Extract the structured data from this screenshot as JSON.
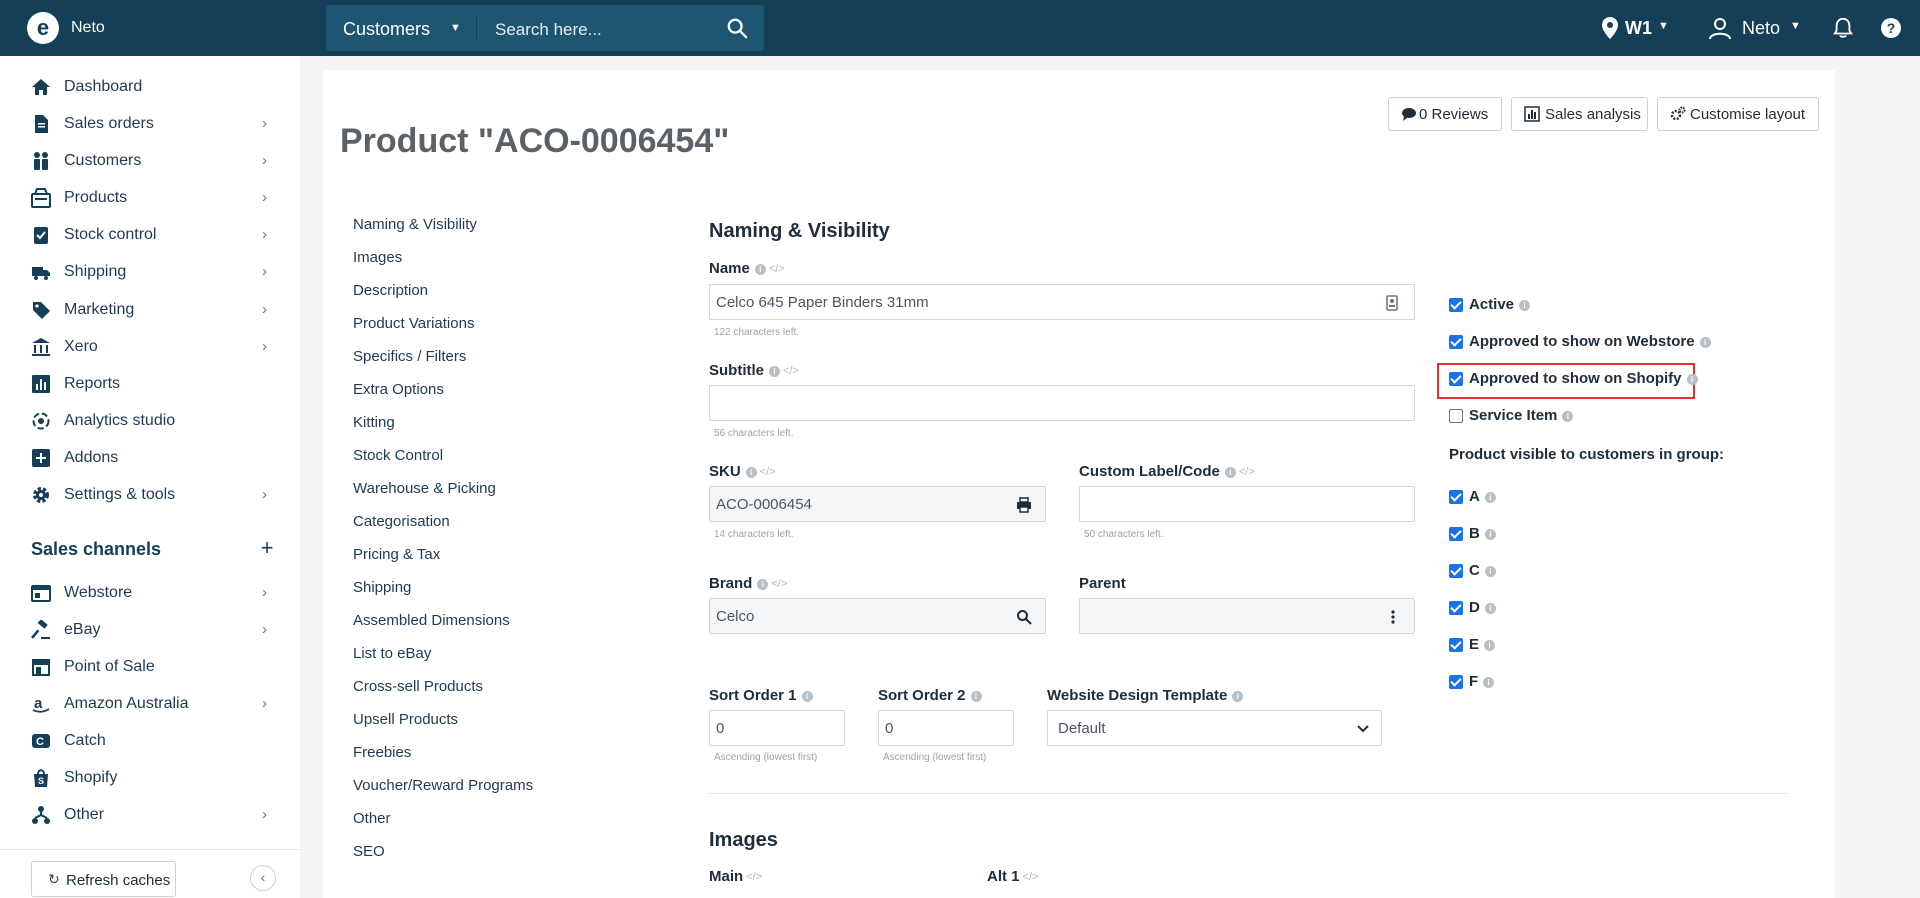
{
  "topbar": {
    "brand": "Neto",
    "search_type": "Customers",
    "search_placeholder": "Search here...",
    "location": "W1",
    "user": "Neto",
    "help": "?"
  },
  "sidebar": {
    "items": [
      {
        "label": "Dashboard",
        "icon": "home-icon"
      },
      {
        "label": "Sales orders",
        "icon": "document-icon"
      },
      {
        "label": "Customers",
        "icon": "people-icon"
      },
      {
        "label": "Products",
        "icon": "products-icon"
      },
      {
        "label": "Stock control",
        "icon": "clipboard-check-icon"
      },
      {
        "label": "Shipping",
        "icon": "truck-icon"
      },
      {
        "label": "Marketing",
        "icon": "tag-icon"
      },
      {
        "label": "Xero",
        "icon": "bank-icon"
      },
      {
        "label": "Reports",
        "icon": "bar-chart-icon"
      },
      {
        "label": "Analytics studio",
        "icon": "analytics-icon"
      },
      {
        "label": "Addons",
        "icon": "plus-square-icon"
      },
      {
        "label": "Settings & tools",
        "icon": "gear-icon"
      }
    ],
    "sales_channels_heading": "Sales channels",
    "sales_channels_add": "+",
    "channels": [
      {
        "label": "Webstore",
        "icon": "webstore-icon"
      },
      {
        "label": "eBay",
        "icon": "gavel-icon"
      },
      {
        "label": "Point of Sale",
        "icon": "store-icon"
      },
      {
        "label": "Amazon Australia",
        "icon": "amazon-icon"
      },
      {
        "label": "Catch",
        "icon": "catch-icon"
      },
      {
        "label": "Shopify",
        "icon": "shopify-bag-icon"
      },
      {
        "label": "Other",
        "icon": "sitemap-icon"
      }
    ],
    "refresh_label": "Refresh caches",
    "collapse_label": "‹"
  },
  "page": {
    "title": "Product \"ACO-0006454\"",
    "buttons": {
      "reviews": "0 Reviews",
      "sales_analysis": "Sales analysis",
      "customise_layout": "Customise layout"
    }
  },
  "section_nav": [
    "Naming & Visibility",
    "Images",
    "Description",
    "Product Variations",
    "Specifics / Filters",
    "Extra Options",
    "Kitting",
    "Stock Control",
    "Warehouse & Picking",
    "Categorisation",
    "Pricing & Tax",
    "Shipping",
    "Assembled Dimensions",
    "List to eBay",
    "Cross-sell Products",
    "Upsell Products",
    "Freebies",
    "Voucher/Reward Programs",
    "Other",
    "SEO"
  ],
  "form": {
    "section_title": "Naming & Visibility",
    "name_label": "Name",
    "name_value": "Celco 645 Paper Binders 31mm",
    "name_helper": "122 characters left.",
    "subtitle_label": "Subtitle",
    "subtitle_value": "",
    "subtitle_helper": "56 characters left.",
    "sku_label": "SKU",
    "sku_value": "ACO-0006454",
    "sku_helper": "14 characters left.",
    "custom_label": "Custom Label/Code",
    "custom_value": "",
    "custom_helper": "50 characters left.",
    "brand_label": "Brand",
    "brand_value": "Celco",
    "parent_label": "Parent",
    "parent_value": "",
    "sort1_label": "Sort Order 1",
    "sort1_value": "0",
    "sort1_helper": "Ascending (lowest first)",
    "sort2_label": "Sort Order 2",
    "sort2_value": "0",
    "sort2_helper": "Ascending (lowest first)",
    "template_label": "Website Design Template",
    "template_value": "Default",
    "images_title": "Images",
    "main_label": "Main",
    "alt1_label": "Alt 1"
  },
  "visibility": {
    "options": [
      {
        "label": "Active",
        "checked": true
      },
      {
        "label": "Approved to show on Webstore",
        "checked": true
      },
      {
        "label": "Approved to show on Shopify",
        "checked": true
      },
      {
        "label": "Service Item",
        "checked": false
      }
    ],
    "group_heading": "Product visible to customers in group:",
    "groups": [
      {
        "label": "A",
        "checked": true
      },
      {
        "label": "B",
        "checked": true
      },
      {
        "label": "C",
        "checked": true
      },
      {
        "label": "D",
        "checked": true
      },
      {
        "label": "E",
        "checked": true
      },
      {
        "label": "F",
        "checked": true
      }
    ]
  },
  "colors": {
    "topbar": "#143f57",
    "accent": "#1a73e8",
    "highlight": "#e03131"
  }
}
